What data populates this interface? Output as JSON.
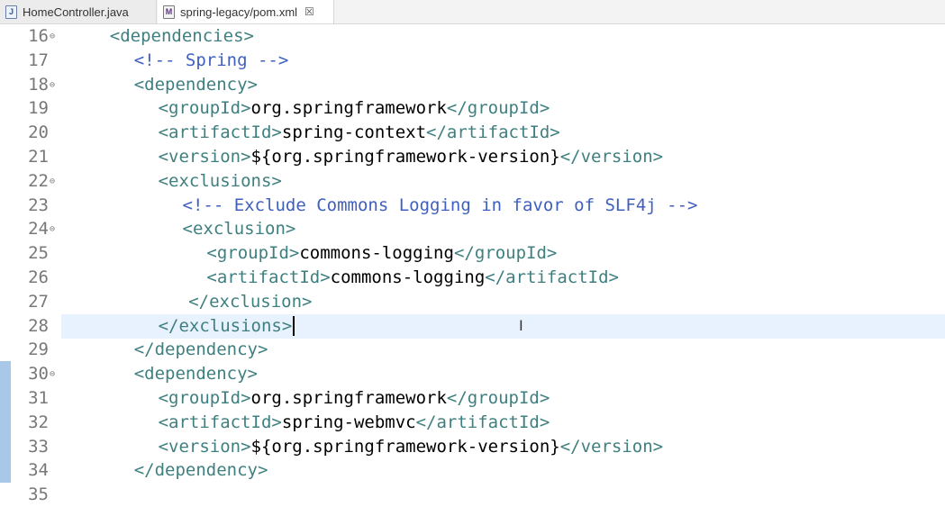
{
  "tabs": [
    {
      "label": "HomeController.java",
      "icon": "java-file-icon",
      "active": false
    },
    {
      "label": "spring-legacy/pom.xml",
      "icon": "xml-file-icon",
      "active": true,
      "close": "☒"
    }
  ],
  "editor": {
    "current_line": 28,
    "lines": [
      {
        "n": "16",
        "fold": true,
        "indent": 4,
        "tokens": [
          [
            "tag",
            "<dependencies>"
          ]
        ]
      },
      {
        "n": "17",
        "fold": false,
        "indent": 6,
        "tokens": [
          [
            "cmt",
            "<!-- Spring -->"
          ]
        ]
      },
      {
        "n": "18",
        "fold": true,
        "indent": 6,
        "tokens": [
          [
            "tag",
            "<dependency>"
          ]
        ]
      },
      {
        "n": "19",
        "fold": false,
        "indent": 8,
        "tokens": [
          [
            "tag",
            "<groupId>"
          ],
          [
            "txt",
            "org.springframework"
          ],
          [
            "tag",
            "</groupId>"
          ]
        ]
      },
      {
        "n": "20",
        "fold": false,
        "indent": 8,
        "tokens": [
          [
            "tag",
            "<artifactId>"
          ],
          [
            "txt",
            "spring-context"
          ],
          [
            "tag",
            "</artifactId>"
          ]
        ]
      },
      {
        "n": "21",
        "fold": false,
        "indent": 8,
        "tokens": [
          [
            "tag",
            "<version>"
          ],
          [
            "txt",
            "${org.springframework-version}"
          ],
          [
            "tag",
            "</version>"
          ]
        ]
      },
      {
        "n": "22",
        "fold": true,
        "indent": 8,
        "tokens": [
          [
            "tag",
            "<exclusions>"
          ]
        ]
      },
      {
        "n": "23",
        "fold": false,
        "indent": 10,
        "tokens": [
          [
            "cmt",
            "<!-- Exclude Commons Logging in favor of SLF4j -->"
          ]
        ]
      },
      {
        "n": "24",
        "fold": true,
        "indent": 10,
        "tokens": [
          [
            "tag",
            "<exclusion>"
          ]
        ]
      },
      {
        "n": "25",
        "fold": false,
        "indent": 12,
        "tokens": [
          [
            "tag",
            "<groupId>"
          ],
          [
            "txt",
            "commons-logging"
          ],
          [
            "tag",
            "</groupId>"
          ]
        ]
      },
      {
        "n": "26",
        "fold": false,
        "indent": 12,
        "tokens": [
          [
            "tag",
            "<artifactId>"
          ],
          [
            "txt",
            "commons-logging"
          ],
          [
            "tag",
            "</artifactId>"
          ]
        ]
      },
      {
        "n": "27",
        "fold": false,
        "indent": 10.5,
        "tokens": [
          [
            "tag",
            "</exclusion>"
          ]
        ]
      },
      {
        "n": "28",
        "fold": false,
        "indent": 8,
        "tokens": [
          [
            "tag",
            "</exclusions>"
          ]
        ]
      },
      {
        "n": "29",
        "fold": false,
        "indent": 6,
        "tokens": [
          [
            "tag",
            "</dependency>"
          ]
        ]
      },
      {
        "n": "30",
        "fold": true,
        "indent": 6,
        "tokens": [
          [
            "tag",
            "<dependency>"
          ]
        ]
      },
      {
        "n": "31",
        "fold": false,
        "indent": 8,
        "tokens": [
          [
            "tag",
            "<groupId>"
          ],
          [
            "txt",
            "org.springframework"
          ],
          [
            "tag",
            "</groupId>"
          ]
        ]
      },
      {
        "n": "32",
        "fold": false,
        "indent": 8,
        "tokens": [
          [
            "tag",
            "<artifactId>"
          ],
          [
            "txt",
            "spring-webmvc"
          ],
          [
            "tag",
            "</artifactId>"
          ]
        ]
      },
      {
        "n": "33",
        "fold": false,
        "indent": 8,
        "tokens": [
          [
            "tag",
            "<version>"
          ],
          [
            "txt",
            "${org.springframework-version}"
          ],
          [
            "tag",
            "</version>"
          ]
        ]
      },
      {
        "n": "34",
        "fold": false,
        "indent": 6,
        "tokens": [
          [
            "tag",
            "</dependency>"
          ]
        ]
      },
      {
        "n": "35",
        "fold": false,
        "indent": 0,
        "tokens": []
      }
    ]
  },
  "colors": {
    "tag": "#3f7f7f",
    "text": "#000000",
    "comment": "#3f5fbf",
    "current_line": "#e8f2fe",
    "line_number": "#787878",
    "change_marker": "#a9c7e6"
  }
}
